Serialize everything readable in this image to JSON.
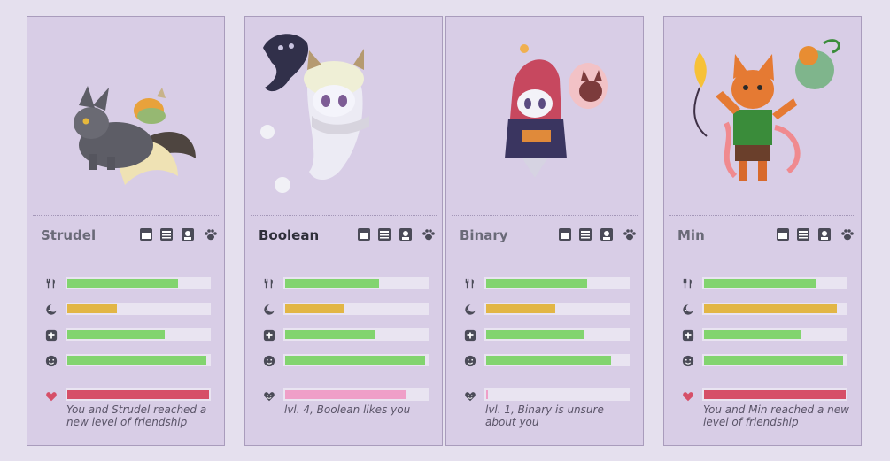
{
  "colors": {
    "hunger_bar": "#82d46f",
    "energy_bar": "#e2b645",
    "health_bar": "#82d46f",
    "mood_bar": "#82d46f",
    "friendship_full": "#d64f68",
    "friendship_liked": "#ef9fc8",
    "friendship_unsure": "#ef9fc8"
  },
  "toolbar_icons": [
    "window-icon",
    "notes-icon",
    "portrait-icon",
    "paw-icon"
  ],
  "stat_icons": [
    "fork-knife-icon",
    "moon-icon",
    "plus-icon",
    "smiley-icon"
  ],
  "pets": [
    {
      "name": "Strudel",
      "active": false,
      "stats": {
        "hunger": 0.78,
        "energy": 0.35,
        "health": 0.69,
        "mood": 0.98
      },
      "friendship": {
        "level": 1.0,
        "icon": "heart-icon",
        "color_key": "friendship_full",
        "text": "You and Strudel reached a new level of friendship"
      }
    },
    {
      "name": "Boolean",
      "active": true,
      "stats": {
        "hunger": 0.66,
        "energy": 0.42,
        "health": 0.63,
        "mood": 0.99
      },
      "friendship": {
        "level": 0.85,
        "icon": "heart-smile-icon",
        "color_key": "friendship_liked",
        "text": "lvl. 4, Boolean likes you"
      }
    },
    {
      "name": "Binary",
      "active": false,
      "stats": {
        "hunger": 0.71,
        "energy": 0.49,
        "health": 0.69,
        "mood": 0.88
      },
      "friendship": {
        "level": 0.01,
        "icon": "heart-smile-icon",
        "color_key": "friendship_unsure",
        "text": "lvl. 1, Binary is unsure about you"
      }
    },
    {
      "name": "Min",
      "active": false,
      "stats": {
        "hunger": 0.79,
        "energy": 0.94,
        "health": 0.68,
        "mood": 0.98
      },
      "friendship": {
        "level": 1.0,
        "icon": "heart-icon",
        "color_key": "friendship_full",
        "text": "You and Min reached a new level of friendship"
      }
    }
  ]
}
